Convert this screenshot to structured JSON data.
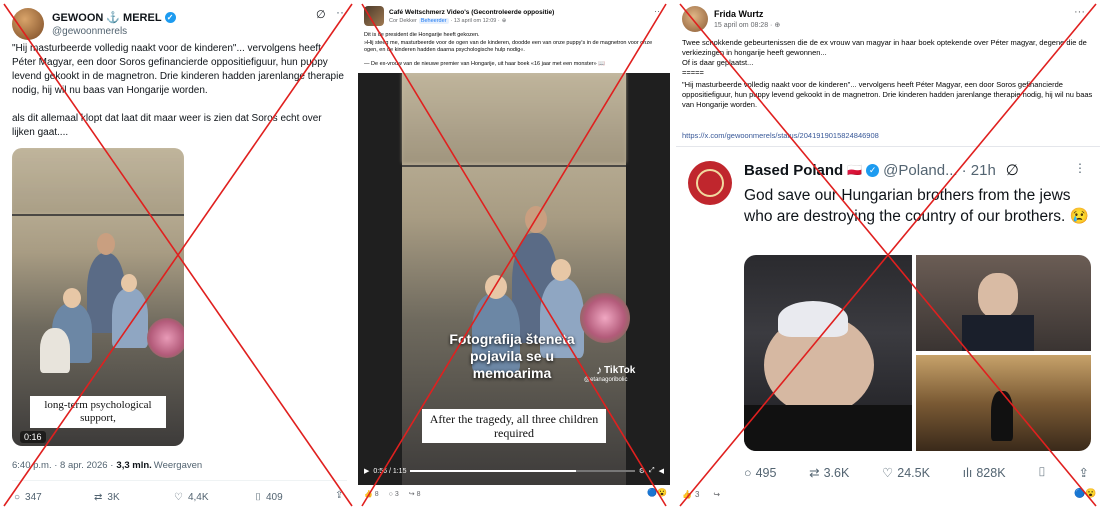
{
  "panel1": {
    "name": "GEWOON",
    "name2": "MEREL",
    "anchor_glyph": "⚓",
    "handle": "@gewoonmerels",
    "text": "\"Hij masturbeerde volledig naakt voor de kinderen\"... vervolgens heeft Péter Magyar, een door Soros gefinancierde oppositiefiguur, hun puppy levend gekookt in de magnetron. Drie kinderen hadden jarenlange therapie nodig, hij wil nu baas van Hongarije worden.",
    "text2": "als dit allemaal klopt dat laat dit maar weer is zien dat Soros echt over lijken gaat....",
    "video_caption": "long-term psychological support,",
    "video_time": "0:16",
    "meta_time": "6:40 p.m. · 8 apr. 2026 · ",
    "meta_views": "3,3 mln.",
    "meta_views_label": " Weergaven",
    "stats": {
      "replies": "347",
      "reposts": "3K",
      "likes": "4,4K",
      "bookmarks": "409"
    }
  },
  "panel2": {
    "page": "Café Weltschmerz Video's (Gecontroleerde oppositie)",
    "author": "Cor Dekker",
    "role": "Beheerder",
    "date": "· 13 april om 12:09 · ",
    "line1": "Dit is de president die Hongarije heeft gekozen.",
    "line2": "»Hij steeg me, masturbeerde voor de ogen van de kinderen, doodde een van onze puppy's in de magnetron voor onze ogen, en de kinderen hadden daarna psychologische hulp nodig«.",
    "line3": "— De ex-vrouw van de nieuwe premier van Hongarije, uit haar boek «16 jaar met een monster» 📖",
    "overlay1": "Fotografija šteneta pojavila se u memoarima",
    "tiktok": "TikTok",
    "tiktok_handle": "@etanagoribolic",
    "caption": "After the tragedy, all three children required",
    "time": "0:56 / 1:15",
    "reactions": {
      "likes": "8",
      "comments": "3",
      "shares": "8"
    }
  },
  "panel3": {
    "author": "Frida Wurtz",
    "date": "15 april om 08:28 · ",
    "line1": "Twee schokkende gebeurtenissen die de ex vrouw van magyar in haar boek optekende over Péter magyar, degene die de verkiezingen in hongarije heeft gewonnen...",
    "line2": "Of is daar geplaatst...",
    "sep": "=====",
    "line3": "\"Hij masturbeerde volledig naakt voor de kinderen\"... vervolgens heeft Péter Magyar, een door Soros gefinancierde oppositiefiguur, hun puppy levend gekookt in de magnetron. Drie kinderen hadden jarenlange therapie nodig, hij wil nu baas van Hongarije worden.",
    "link": "https://x.com/gewoonmerels/status/2041919015824846908",
    "embed": {
      "name": "Based Poland",
      "flag": "🇵🇱",
      "handle": "@Poland...",
      "time": "· 21h",
      "text": "God save our Hungarian brothers from the jews who are destroying the country of our brothers. 😢",
      "stats": {
        "replies": "495",
        "reposts": "3.6K",
        "likes": "24.5K",
        "views": "828K"
      }
    },
    "reactions": "3"
  },
  "colors": {
    "cross": "#e0201f",
    "x_blue": "#1d9bf0",
    "fb_blue": "#1877f2",
    "verified": "#1d9bf0"
  }
}
